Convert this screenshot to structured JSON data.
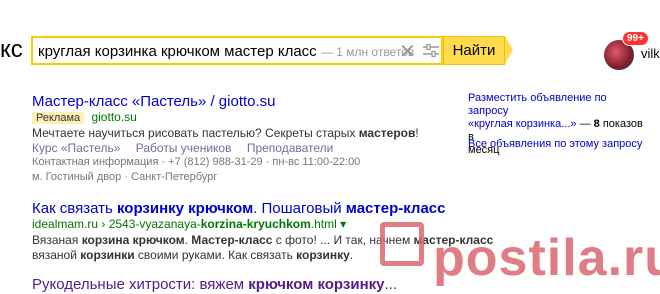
{
  "header": {
    "logo": "кс",
    "search_value": "круглая корзинка крючком мастер класс",
    "search_hint": "— 1 млн ответов",
    "clear_icon": "close-icon",
    "filter_icon": "filter-icon",
    "search_button": "Найти",
    "badge": "99+",
    "user": "vilk"
  },
  "results": [
    {
      "title_plain": "Мастер-класс «Пастель» / giotto.su",
      "ad_label": "Реклама",
      "url": "giotto.su",
      "snippet_prefix": "Мечтаете научиться рисовать пастелью? Секреты старых ",
      "snippet_bold": "мастеров",
      "snippet_suffix": "!",
      "sitelinks": [
        "Курс «Пастель»",
        "Работы учеников",
        "Преподаватели"
      ],
      "contact": "Контактная информация · +7 (812) 988-31-29 · пн-вс 11:00-22:00",
      "address": "м. Гостиный двор · Санкт-Петербург"
    },
    {
      "title_a": "Как связать ",
      "title_b": "корзинку крючком",
      "title_c": ". Пошаговый ",
      "title_d": "мастер-класс",
      "url_a": "idealmam.ru › 2543-vyazanaya-",
      "url_b": "korzina-kryuchkom",
      "url_c": ".html",
      "line1_a": "Вязаная ",
      "line1_b": "корзина крючком",
      "line1_c": ". ",
      "line1_d": "Мастер-класс",
      "line1_e": " с фото! ... И так, начнем ",
      "line1_f": "мастер-класс",
      "line2_a": "вязаной ",
      "line2_b": "корзинки",
      "line2_c": " своими руками. Как связать ",
      "line2_d": "корзинку",
      "line2_e": "."
    },
    {
      "title_a": "Рукодельные хитрости: вяжем ",
      "title_b": "крючком корзинку",
      "title_c": "..."
    }
  ],
  "sidebar": {
    "promo_line1": "Разместить объявление по запросу",
    "promo_line2_a": "«круглая корзинка...»",
    "promo_line2_b": " — ",
    "promo_count": "8",
    "promo_line2_c": " показов в",
    "promo_line3": "месяц",
    "all_ads": "Все объявления по этому запросу"
  },
  "watermark": "postila.ru"
}
